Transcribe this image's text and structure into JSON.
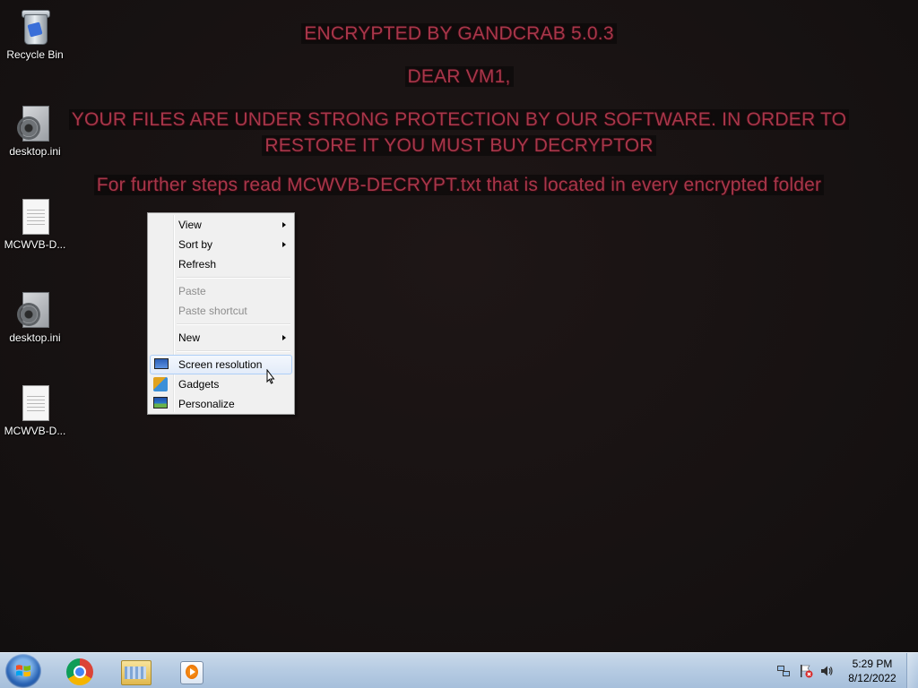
{
  "wallpaper": {
    "title": "ENCRYPTED BY GANDCRAB 5.0.3",
    "greeting": "DEAR VM1,",
    "message_line1": "YOUR FILES ARE UNDER STRONG PROTECTION BY OUR SOFTWARE. IN ORDER TO",
    "message_line2": "RESTORE IT YOU MUST BUY DECRYPTOR",
    "instructions": "For further steps read MCWVB-DECRYPT.txt that is located in every encrypted folder",
    "text_color": "#a8364a"
  },
  "desktop_icons": [
    {
      "label": "Recycle Bin",
      "icon": "recycle-bin-icon"
    },
    {
      "label": "desktop.ini",
      "icon": "settings-file-icon"
    },
    {
      "label": "MCWVB-D...",
      "icon": "text-file-icon"
    },
    {
      "label": "desktop.ini",
      "icon": "settings-file-icon"
    },
    {
      "label": "MCWVB-D...",
      "icon": "text-file-icon"
    }
  ],
  "context_menu": {
    "items": [
      {
        "label": "View",
        "submenu": true
      },
      {
        "label": "Sort by",
        "submenu": true
      },
      {
        "label": "Refresh"
      },
      {
        "label": "Paste",
        "disabled": true
      },
      {
        "label": "Paste shortcut",
        "disabled": true
      },
      {
        "label": "New",
        "submenu": true
      },
      {
        "label": "Screen resolution",
        "icon": "monitor-icon",
        "highlighted": true
      },
      {
        "label": "Gadgets",
        "icon": "gadgets-icon"
      },
      {
        "label": "Personalize",
        "icon": "personalize-icon"
      }
    ]
  },
  "taskbar": {
    "apps": [
      {
        "name": "Google Chrome",
        "icon": "chrome-icon"
      },
      {
        "name": "Windows Explorer",
        "icon": "folder-icon"
      },
      {
        "name": "Windows Media Player",
        "icon": "media-player-icon"
      }
    ],
    "clock": {
      "time": "5:29 PM",
      "date": "8/12/2022"
    }
  },
  "colors": {
    "taskbar": "#b7cce3",
    "menu_background": "#f0f0f0",
    "menu_highlight": "#e3ecf9"
  }
}
